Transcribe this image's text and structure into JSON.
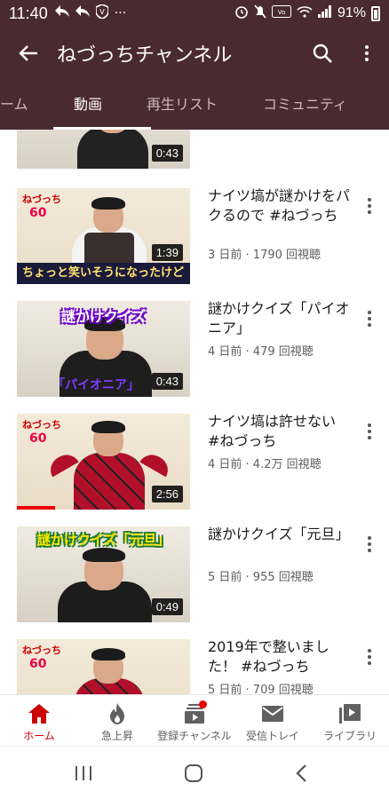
{
  "status_bar": {
    "time": "11:40",
    "battery": "91%"
  },
  "app_bar": {
    "title": "ねづっちチャンネル",
    "icons": [
      "back-arrow-icon",
      "search-icon",
      "more-vert-icon"
    ]
  },
  "tabs": [
    {
      "label": "ーム",
      "active": false
    },
    {
      "label": "動画",
      "active": true
    },
    {
      "label": "再生リスト",
      "active": false
    },
    {
      "label": "コミュニティ",
      "active": false
    }
  ],
  "videos": [
    {
      "title": "",
      "meta": "",
      "duration": "0:43"
    },
    {
      "title": "ナイツ塙が謎かけをパクるので #ねづっち",
      "meta": "3 日前 · 1790 回視聴",
      "duration": "1:39",
      "thumb_caption": "ちょっと笑いそうになったけど"
    },
    {
      "title": "謎かけクイズ「パイオニア」",
      "meta": "4 日前 · 479 回視聴",
      "duration": "0:43",
      "thumb_top": "謎かけクイズ",
      "thumb_bottom": "「パイオニア」"
    },
    {
      "title": "ナイツ塙は許せない #ねづっち",
      "meta": "4 日前 · 4.2万 回視聴",
      "duration": "2:56",
      "watched_fraction": 0.22
    },
    {
      "title": "謎かけクイズ「元旦」",
      "meta": "5 日前 · 955 回視聴",
      "duration": "0:49",
      "thumb_top": "謎かけクイズ「元旦」"
    },
    {
      "title": "2019年で整いました！ #ねづっち",
      "meta": "5 日前 · 709 回視聴",
      "duration": ""
    }
  ],
  "bottom_nav": [
    {
      "label": "ホーム",
      "icon": "home-icon",
      "active": true
    },
    {
      "label": "急上昇",
      "icon": "trending-flame-icon",
      "active": false
    },
    {
      "label": "登録チャンネル",
      "icon": "subscriptions-icon",
      "active": false,
      "has_dot": true
    },
    {
      "label": "受信トレイ",
      "icon": "inbox-mail-icon",
      "active": false
    },
    {
      "label": "ライブラリ",
      "icon": "library-icon",
      "active": false
    }
  ],
  "colors": {
    "header": "#4a2a31",
    "accent": "#cc0000"
  }
}
